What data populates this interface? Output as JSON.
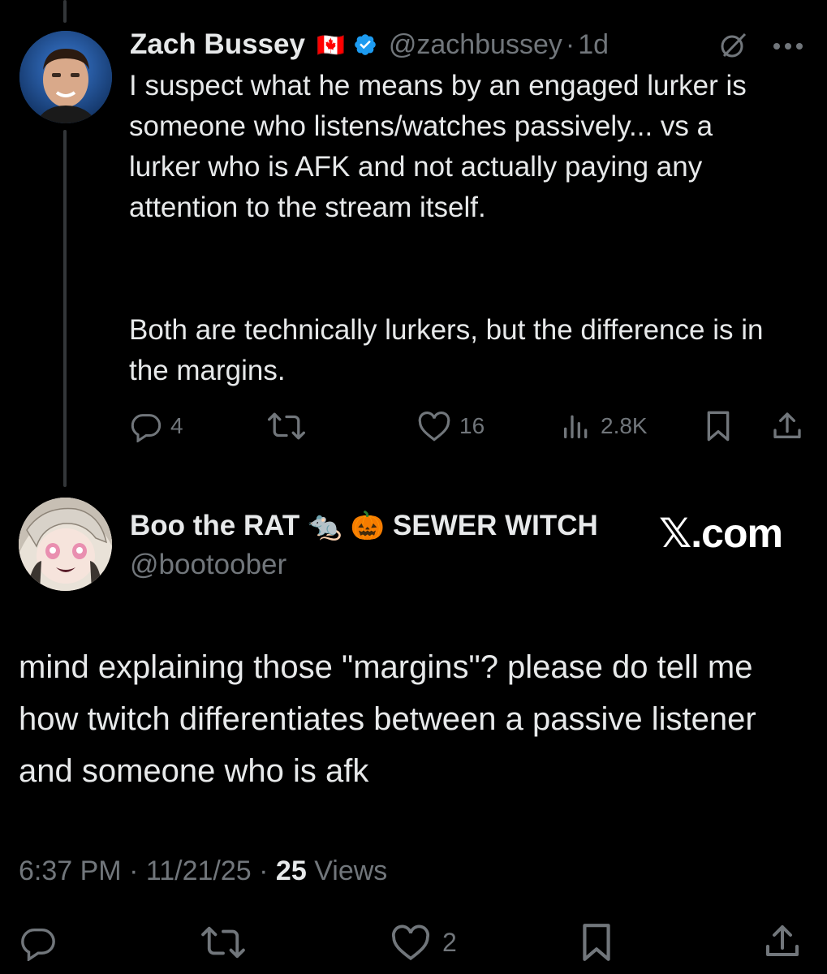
{
  "parent_tweet": {
    "display_name": "Zach Bussey",
    "flag_emoji": "🇨🇦",
    "handle": "@zachbussey",
    "separator": "·",
    "age": "1d",
    "text_paragraph_1": "I suspect what he means by an engaged lurker is someone who listens/watches passively... vs a lurker who is AFK and not actually paying any attention to the stream itself.",
    "text_paragraph_2": "Both are technically lurkers, but the difference is in the margins.",
    "stats": {
      "replies": "4",
      "likes": "16",
      "views": "2.8K"
    }
  },
  "main_tweet": {
    "display_name": "Boo the RAT",
    "name_emoji_1": "🐀",
    "name_emoji_2": "🎃",
    "name_suffix": "SEWER WITCH",
    "handle": "@bootoober",
    "watermark": "𝕏.com",
    "text": "mind explaining those \"margins\"? please do tell me how twitch differentiates between a passive listener and someone who is afk",
    "time": "6:37 PM",
    "date": "11/21/25",
    "sep": "·",
    "views_count": "25",
    "views_label": "Views",
    "stats": {
      "likes": "2"
    }
  },
  "colors": {
    "background": "#000000",
    "text": "#e7e9ea",
    "muted": "#71767b",
    "verified": "#1d9bf0"
  },
  "icons": [
    "reply-icon",
    "retweet-icon",
    "like-icon",
    "views-icon",
    "bookmark-icon",
    "share-icon",
    "grok-icon",
    "more-icon",
    "verified-icon"
  ]
}
